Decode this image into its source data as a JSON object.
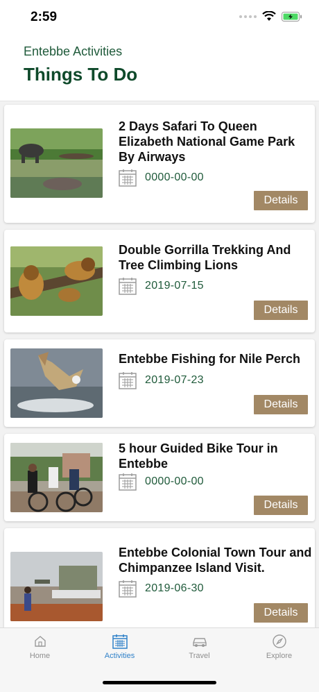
{
  "status": {
    "time": "2:59"
  },
  "header": {
    "subtitle": "Entebbe Activities",
    "title": "Things To Do"
  },
  "activities": [
    {
      "title": "2 Days Safari To Queen Elizabeth National Game Park By Airways",
      "date": "0000-00-00",
      "button": "Details"
    },
    {
      "title": "Double Gorrilla Trekking And Tree Climbing Lions",
      "date": "2019-07-15",
      "button": "Details"
    },
    {
      "title": "Entebbe Fishing for Nile Perch",
      "date": "2019-07-23",
      "button": "Details"
    },
    {
      "title": "5 hour Guided Bike Tour in Entebbe",
      "date": "0000-00-00",
      "button": "Details"
    },
    {
      "title": "Entebbe Colonial Town Tour and Chimpanzee Island Visit.",
      "date": "2019-06-30",
      "button": "Details"
    }
  ],
  "tabs": [
    {
      "label": "Home",
      "icon": "home-icon"
    },
    {
      "label": "Activities",
      "icon": "calendar-icon",
      "active": true
    },
    {
      "label": "Travel",
      "icon": "car-icon"
    },
    {
      "label": "Explore",
      "icon": "compass-icon"
    }
  ],
  "colors": {
    "accent": "#a28865",
    "title_green": "#0f4a2b",
    "tab_active": "#2f80c8"
  }
}
